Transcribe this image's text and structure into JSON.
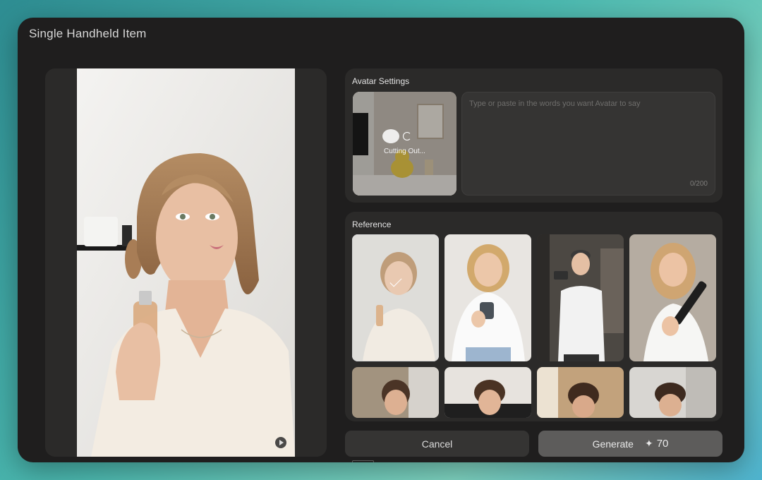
{
  "modal": {
    "title": "Single Handheld Item"
  },
  "preview": {
    "play_icon": "play-icon"
  },
  "avatar_settings": {
    "title": "Avatar Settings",
    "status": "Cutting Out...",
    "script_placeholder": "Type or paste in the words you want Avatar to say",
    "script_value": "",
    "char_count": "0/200"
  },
  "reference": {
    "title": "Reference",
    "selected_index": 0,
    "thumbnails": [
      "ref-1",
      "ref-2",
      "ref-3",
      "ref-4",
      "ref-5",
      "ref-6",
      "ref-7",
      "ref-8"
    ]
  },
  "actions": {
    "cancel_label": "Cancel",
    "generate_label": "Generate",
    "generate_icon": "sparkle-icon",
    "sparkle_glyph": "✦",
    "generate_cost": "70"
  },
  "colors": {
    "modal_bg": "#1f1e1e",
    "card_bg": "#2b2a29",
    "generate_bg": "#5d5c5b"
  }
}
